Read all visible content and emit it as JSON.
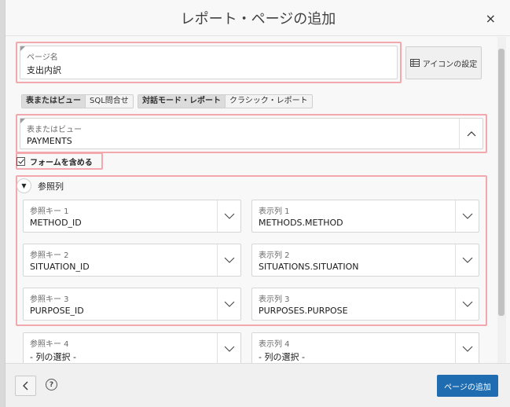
{
  "dialog": {
    "title": "レポート・ページの追加",
    "close_glyph": "×"
  },
  "page_name": {
    "label": "ページ名",
    "value": "支出内訳"
  },
  "icon_button": {
    "label": "アイコンの設定",
    "icon": "table-icon"
  },
  "source_toggle": {
    "options": [
      "表またはビュー",
      "SQL問合せ"
    ],
    "selected": "表またはビュー"
  },
  "mode_toggle": {
    "options": [
      "対話モード・レポート",
      "クラシック・レポート"
    ],
    "selected": "対話モード・レポート"
  },
  "table_view": {
    "label": "表またはビュー",
    "value": "PAYMENTS"
  },
  "include_form": {
    "label": "フォームを含める",
    "checked": true
  },
  "lookup": {
    "title": "参照列",
    "rows": [
      {
        "key_label": "参照キー 1",
        "key_value": "METHOD_ID",
        "disp_label": "表示列 1",
        "disp_value": "METHODS.METHOD"
      },
      {
        "key_label": "参照キー 2",
        "key_value": "SITUATION_ID",
        "disp_label": "表示列 2",
        "disp_value": "SITUATIONS.SITUATION"
      },
      {
        "key_label": "参照キー 3",
        "key_value": "PURPOSE_ID",
        "disp_label": "表示列 3",
        "disp_value": "PURPOSES.PURPOSE"
      },
      {
        "key_label": "参照キー 4",
        "key_value": "- 列の選択 -",
        "disp_label": "表示列 4",
        "disp_value": "- 列の選択 -"
      }
    ]
  },
  "footer": {
    "primary_label": "ページの追加",
    "help_glyph": "?"
  },
  "colors": {
    "highlight": "#f3a8ad",
    "primary": "#1f6cb0"
  }
}
